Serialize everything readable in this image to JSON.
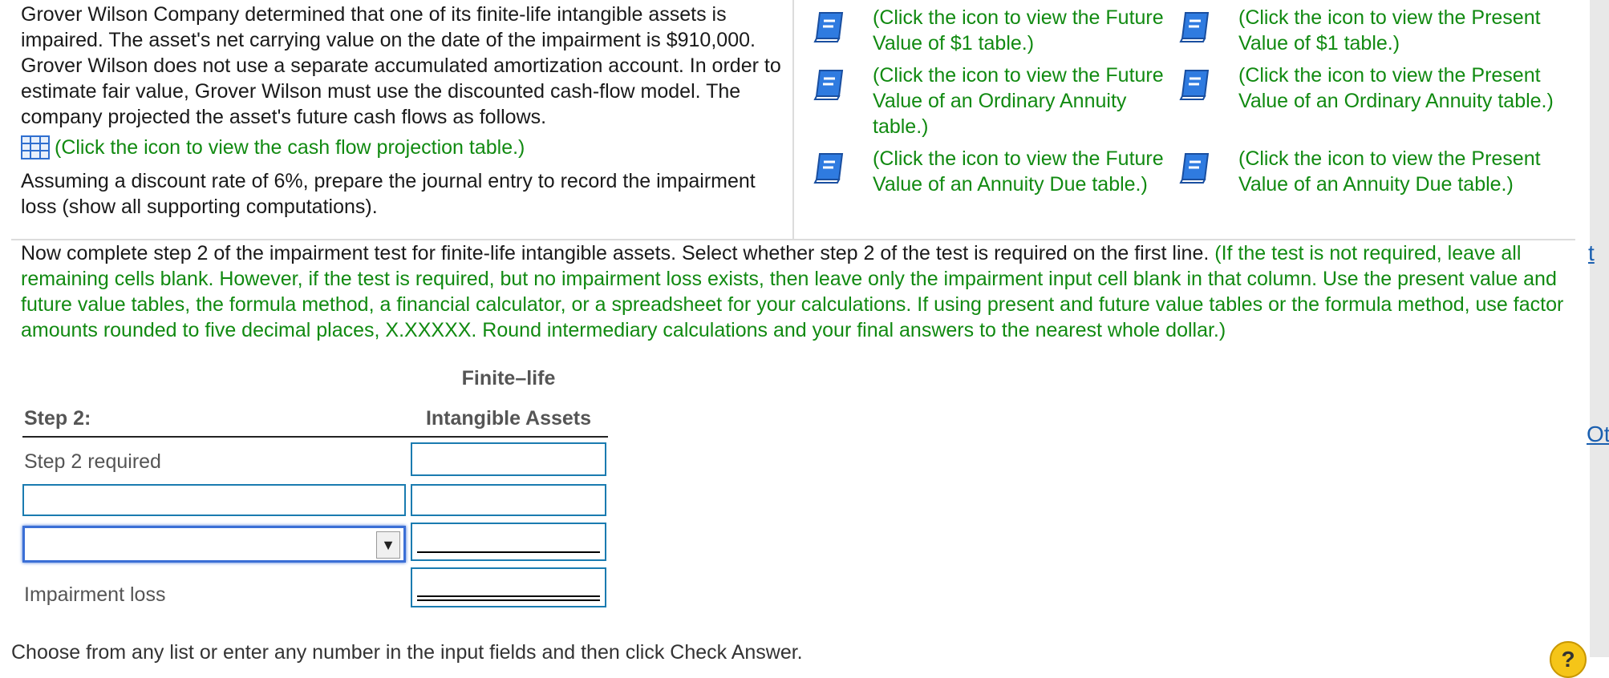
{
  "problem": {
    "intro": "Grover Wilson Company determined that one of its finite-life intangible assets is impaired. The asset's net carrying value on the date of the impairment is $910,000. Grover Wilson does not use a separate accumulated amortization account. In order to estimate fair value, Grover Wilson must use the discounted cash-flow model. The company projected the asset's future cash flows as follows.",
    "cashflow_link": "(Click the icon to view the cash flow projection table.)",
    "instruction": "Assuming a discount rate of 6%, prepare the journal entry to record the impairment loss (show all supporting computations)."
  },
  "table_links": {
    "fv1": "(Click the icon to view the Future Value of $1 table.)",
    "pv1": "(Click the icon to view the Present Value of $1 table.)",
    "fv_ordinary": "(Click the icon to view the Future Value of an Ordinary Annuity table.)",
    "pv_ordinary": "(Click the icon to view the Present Value of an Ordinary Annuity table.)",
    "fv_due": "(Click the icon to view the Future Value of an Annuity Due table.)",
    "pv_due": "(Click the icon to view the Present Value of an Annuity Due table.)"
  },
  "step": {
    "main": "Now complete step 2 of the impairment test for finite-life intangible assets. Select whether step 2 of the test is required on the first line.",
    "note": "(If the test is not required, leave all remaining cells blank. However, if the test is required, but no impairment loss exists, then leave only the impairment input cell blank in that column. Use the present value and future value tables, the formula method, a financial calculator, or a spreadsheet for your calculations. If using present and future value tables or the formula method, use factor amounts rounded to five decimal places, X.XXXXX. Round intermediary calculations and your final answers to the nearest whole dollar.)"
  },
  "answer_table": {
    "col_header_1": "Finite–life",
    "col_header_2": "Intangible Assets",
    "step_label": "Step 2:",
    "row1_label": "Step 2 required",
    "row4_label": "Impairment loss"
  },
  "edge": {
    "t": "t",
    "ot": "Ot"
  },
  "footer": "Choose from any list or enter any number in the input fields and then click Check Answer.",
  "help": "?",
  "dropdown_arrow": "▼",
  "colors": {
    "link_green": "#118a11",
    "input_border": "#1a7bb0",
    "focus_blue": "#3b6fd6"
  }
}
